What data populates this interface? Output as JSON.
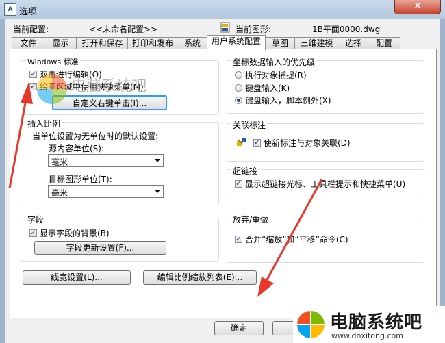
{
  "window": {
    "title": "选项",
    "icon": "autocad-app-icon",
    "close_label": "✕"
  },
  "header": {
    "current_profile_label": "当前配置:",
    "current_profile_value": "<<未命名配置>>",
    "current_drawing_label": "当前图形:",
    "current_drawing_value": "1B平面0000.dwg"
  },
  "tabs": [
    {
      "label": "文件"
    },
    {
      "label": "显示"
    },
    {
      "label": "打开和保存"
    },
    {
      "label": "打印和发布"
    },
    {
      "label": "系统"
    },
    {
      "label": "用户系统配置",
      "active": true
    },
    {
      "label": "草图"
    },
    {
      "label": "三维建模"
    },
    {
      "label": "选择"
    },
    {
      "label": "配置"
    }
  ],
  "windows_std": {
    "title": "Windows 标准",
    "dblclick_label": "双击进行编辑(O)",
    "dblclick_checked": true,
    "shortcut_label": "绘图区域中使用快捷菜单(M)",
    "shortcut_checked": true,
    "custom_right_click": "自定义右键单击(I)..."
  },
  "coord": {
    "title": "坐标数据输入的优先级",
    "opt1": "执行对象捕捉(R)",
    "opt2": "键盘输入(K)",
    "opt3": "键盘输入，脚本例外(X)",
    "selected": 3
  },
  "insert_scale": {
    "title": "插入比例",
    "desc": "当单位设置为无单位时的默认设置:",
    "src_label": "源内容单位(S):",
    "src_value": "毫米",
    "tgt_label": "目标图形单位(T):",
    "tgt_value": "毫米"
  },
  "assoc": {
    "title": "关联标注",
    "label": "使新标注与对象关联(D)",
    "checked": true,
    "icon": "dimension-icon"
  },
  "hyperlink": {
    "title": "超链接",
    "label": "显示超链接光标、工具栏提示和快捷菜单(U)",
    "checked": true
  },
  "fields": {
    "title": "字段",
    "label": "显示字段的背景(B)",
    "checked": true,
    "update_btn": "字段更新设置(F)..."
  },
  "undo": {
    "title": "放弃/重做",
    "label": "合并“缩放”和“平移”命令(C)",
    "checked": true
  },
  "bottom_buttons": {
    "lineweight": "线宽设置(L)...",
    "scale_list": "编辑比例缩放列表(E)..."
  },
  "footer": {
    "ok": "确定",
    "cancel": "取"
  },
  "watermark": {
    "cn": "电脑系统吧",
    "url": "www.dnxitong.com"
  },
  "watermark_top": {
    "text": "电脑系统吧"
  },
  "colors": {
    "arrow": "#e9372b",
    "accent": "#3399ff"
  }
}
